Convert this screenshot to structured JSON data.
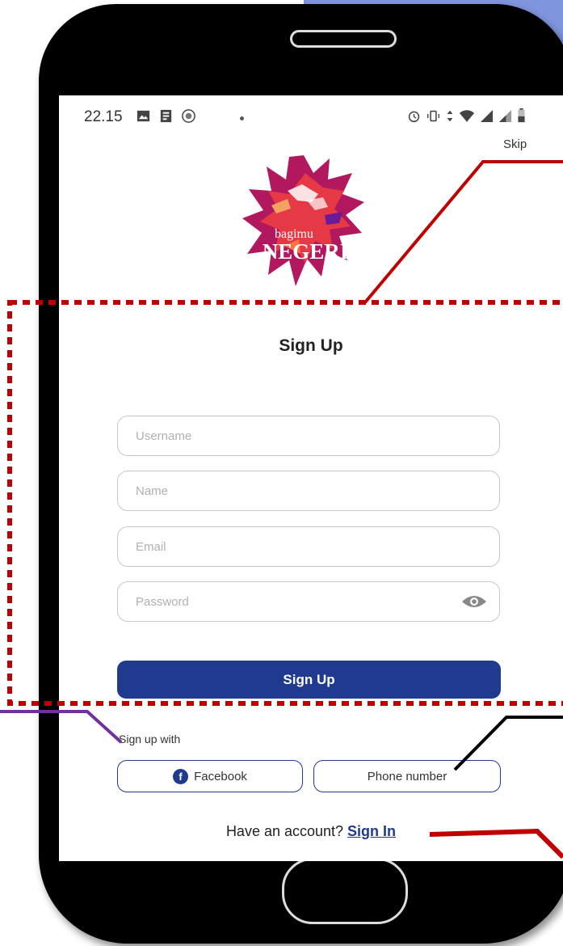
{
  "status_bar": {
    "time": "22.15",
    "left_icons": [
      "image-icon",
      "news-icon",
      "app-icon"
    ],
    "right_icons": [
      "alarm-icon",
      "vibrate-icon",
      "data-icon",
      "wifi-icon",
      "signal-icon",
      "signal-icon-2",
      "battery-icon"
    ]
  },
  "header": {
    "skip_label": "Skip"
  },
  "logo": {
    "line1": "bagimu",
    "line2": "NEGERI"
  },
  "form": {
    "title": "Sign Up",
    "username_placeholder": "Username",
    "name_placeholder": "Name",
    "email_placeholder": "Email",
    "password_placeholder": "Password",
    "submit_label": "Sign Up"
  },
  "social": {
    "label": "Sign up with",
    "facebook_label": "Facebook",
    "facebook_glyph": "f",
    "phone_label": "Phone number"
  },
  "footer": {
    "question": "Have an account? ",
    "signin_label": "Sign In"
  },
  "colors": {
    "primary": "#1f3a8f",
    "annotation_red": "#c00000",
    "annotation_purple": "#7030a0",
    "annotation_black": "#000000",
    "background_accent": "#7f95dd"
  }
}
